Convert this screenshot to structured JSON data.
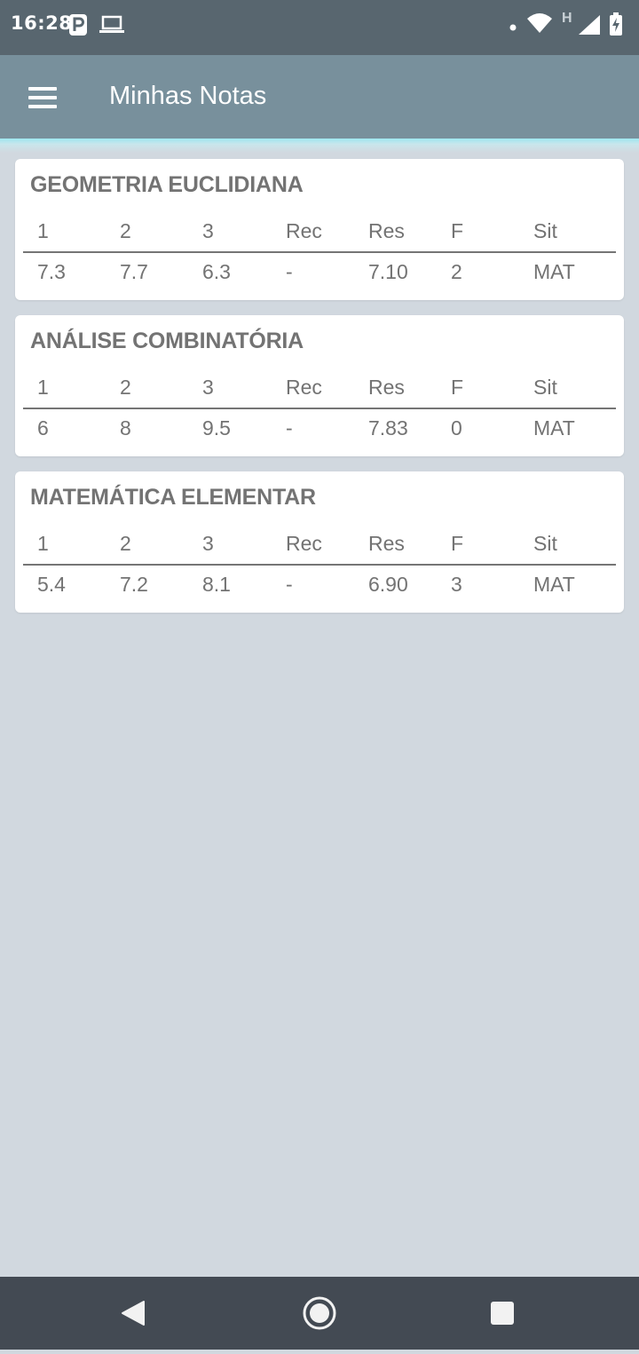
{
  "status_bar": {
    "time": "16:28",
    "icons": [
      "parking-icon",
      "laptop-icon",
      "dot-icon",
      "wifi-icon",
      "h-signal-icon",
      "cell-signal-icon",
      "battery-charging-icon"
    ]
  },
  "app_bar": {
    "title": "Minhas Notas",
    "menu_icon": "hamburger-menu-icon"
  },
  "grade_columns": [
    "1",
    "2",
    "3",
    "Rec",
    "Res",
    "F",
    "Sit"
  ],
  "courses": [
    {
      "name": "GEOMETRIA EUCLIDIANA",
      "values": [
        "7.3",
        "7.7",
        "6.3",
        "-",
        "7.10",
        "2",
        "MAT"
      ]
    },
    {
      "name": "ANÁLISE COMBINATÓRIA",
      "values": [
        "6",
        "8",
        "9.5",
        "-",
        "7.83",
        "0",
        "MAT"
      ]
    },
    {
      "name": "MATEMÁTICA ELEMENTAR",
      "values": [
        "5.4",
        "7.2",
        "8.1",
        "-",
        "6.90",
        "3",
        "MAT"
      ]
    }
  ],
  "nav_bar": {
    "icons": [
      "back-icon",
      "home-icon",
      "recents-icon"
    ]
  },
  "colors": {
    "status_bar": "#58666f",
    "app_bar": "#78909c",
    "background": "#d1d8df",
    "card_text": "#737373",
    "nav_bar": "#434a53"
  }
}
